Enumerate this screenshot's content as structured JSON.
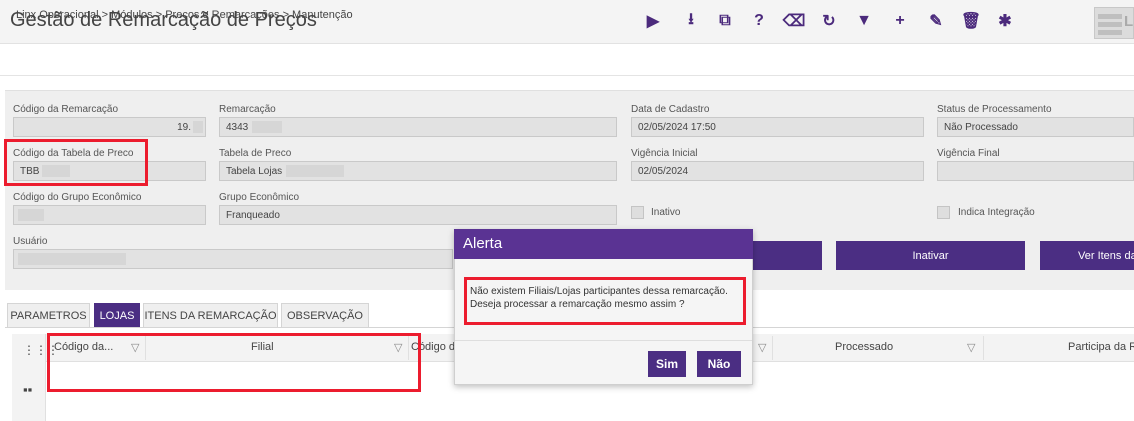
{
  "header": {
    "title": "Gestão de Remarcação de Preços",
    "toolbar_icons": [
      {
        "name": "youtube-icon",
        "glyph": "▶"
      },
      {
        "name": "download-icon",
        "glyph": "⭳"
      },
      {
        "name": "copy-icon",
        "glyph": "⧉"
      },
      {
        "name": "help-icon",
        "glyph": "?"
      },
      {
        "name": "eraser-icon",
        "glyph": "⌫"
      },
      {
        "name": "refresh-icon",
        "glyph": "↻"
      },
      {
        "name": "filter-icon",
        "glyph": "▼"
      },
      {
        "name": "add-icon",
        "glyph": "+"
      },
      {
        "name": "edit-icon",
        "glyph": "✎"
      },
      {
        "name": "delete-icon",
        "glyph": "🗑"
      },
      {
        "name": "settings-icon",
        "glyph": "✱"
      }
    ],
    "logo_text": "L"
  },
  "breadcrumb": "Linx Operacional > Módulos > Preços e Remarcações > Manutenção",
  "form": {
    "codigo_remarcacao": {
      "label": "Código da Remarcação",
      "value": "19."
    },
    "remarcacao": {
      "label": "Remarcação",
      "value": "4343"
    },
    "data_cadastro": {
      "label": "Data de Cadastro",
      "value": "02/05/2024 17:50"
    },
    "status": {
      "label": "Status de Processamento",
      "value": "Não Processado"
    },
    "codigo_tabela": {
      "label": "Código da Tabela de Preco",
      "value": "TBB"
    },
    "tabela": {
      "label": "Tabela de Preco",
      "value": "Tabela Lojas"
    },
    "vigencia_inicial": {
      "label": "Vigência Inicial",
      "value": "02/05/2024"
    },
    "vigencia_final": {
      "label": "Vigência Final",
      "value": ""
    },
    "codigo_grupo": {
      "label": "Código do Grupo Econômico",
      "value": ""
    },
    "grupo": {
      "label": "Grupo Econômico",
      "value": "Franqueado"
    },
    "inativo_label": "Inativo",
    "indica_integracao_label": "Indica Integração",
    "usuario": {
      "label": "Usuário",
      "value": ""
    },
    "buttons": {
      "inativar": "Inativar",
      "ver_itens": "Ver Itens da"
    }
  },
  "tabs": [
    "PARAMETROS",
    "LOJAS",
    "ITENS DA REMARCAÇÃO",
    "OBSERVAÇÃO"
  ],
  "grid": {
    "columns": [
      "Código da...",
      "Filial",
      "Código da",
      "Processado",
      "Participa da Re"
    ],
    "filter_glyph": "▽"
  },
  "modal": {
    "title": "Alerta",
    "message_line1": "Não existem Filiais/Lojas participantes dessa remarcação.",
    "message_line2": "Deseja processar a remarcação mesmo assim ?",
    "yes": "Sim",
    "no": "Não"
  },
  "colors": {
    "primary": "#4b2e83",
    "modal_header": "#5a3393",
    "highlight": "#ec1c2e"
  }
}
